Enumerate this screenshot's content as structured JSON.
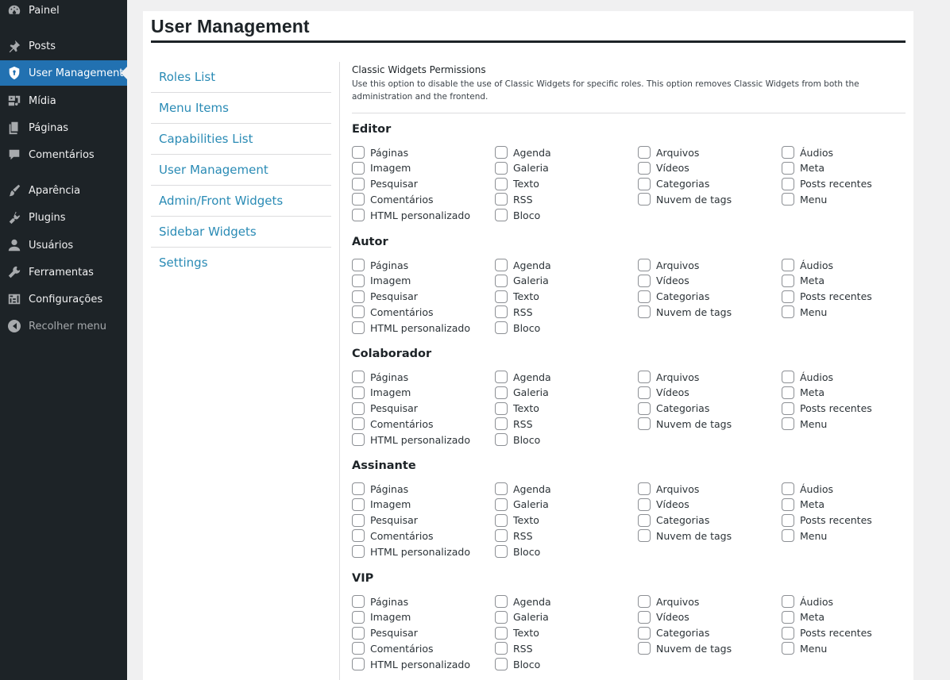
{
  "sidebar": {
    "items": [
      {
        "label": "Painel",
        "icon": "dashboard-icon"
      },
      {
        "label": "Posts",
        "icon": "pin-icon"
      },
      {
        "label": "User Management",
        "icon": "shield-icon",
        "current": true
      },
      {
        "label": "Mídia",
        "icon": "media-icon"
      },
      {
        "label": "Páginas",
        "icon": "pages-icon"
      },
      {
        "label": "Comentários",
        "icon": "comments-icon"
      },
      {
        "label": "Aparência",
        "icon": "brush-icon"
      },
      {
        "label": "Plugins",
        "icon": "plugin-icon"
      },
      {
        "label": "Usuários",
        "icon": "users-icon"
      },
      {
        "label": "Ferramentas",
        "icon": "wrench-icon"
      },
      {
        "label": "Configurações",
        "icon": "settings-icon"
      }
    ],
    "collapse_label": "Recolher menu"
  },
  "page": {
    "title": "User Management"
  },
  "subnav": {
    "links": [
      "Roles List",
      "Menu Items",
      "Capabilities List",
      "User Management",
      "Admin/Front Widgets",
      "Sidebar Widgets",
      "Settings"
    ]
  },
  "section": {
    "title": "Classic Widgets Permissions",
    "description": "Use this option to disable the use of Classic Widgets for specific roles. This option removes Classic Widgets from both the administration and the frontend."
  },
  "widget_columns": [
    [
      "Páginas",
      "Imagem",
      "Pesquisar",
      "Comentários",
      "HTML personalizado"
    ],
    [
      "Agenda",
      "Galeria",
      "Texto",
      "RSS",
      "Bloco"
    ],
    [
      "Arquivos",
      "Vídeos",
      "Categorias",
      "Nuvem de tags"
    ],
    [
      "Áudios",
      "Meta",
      "Posts recentes",
      "Menu"
    ]
  ],
  "roles": [
    "Editor",
    "Autor",
    "Colaborador",
    "Assinante",
    "VIP"
  ],
  "colors": {
    "sidebar_bg": "#1d2327",
    "accent": "#2271b1",
    "link": "#2a8bb5"
  }
}
